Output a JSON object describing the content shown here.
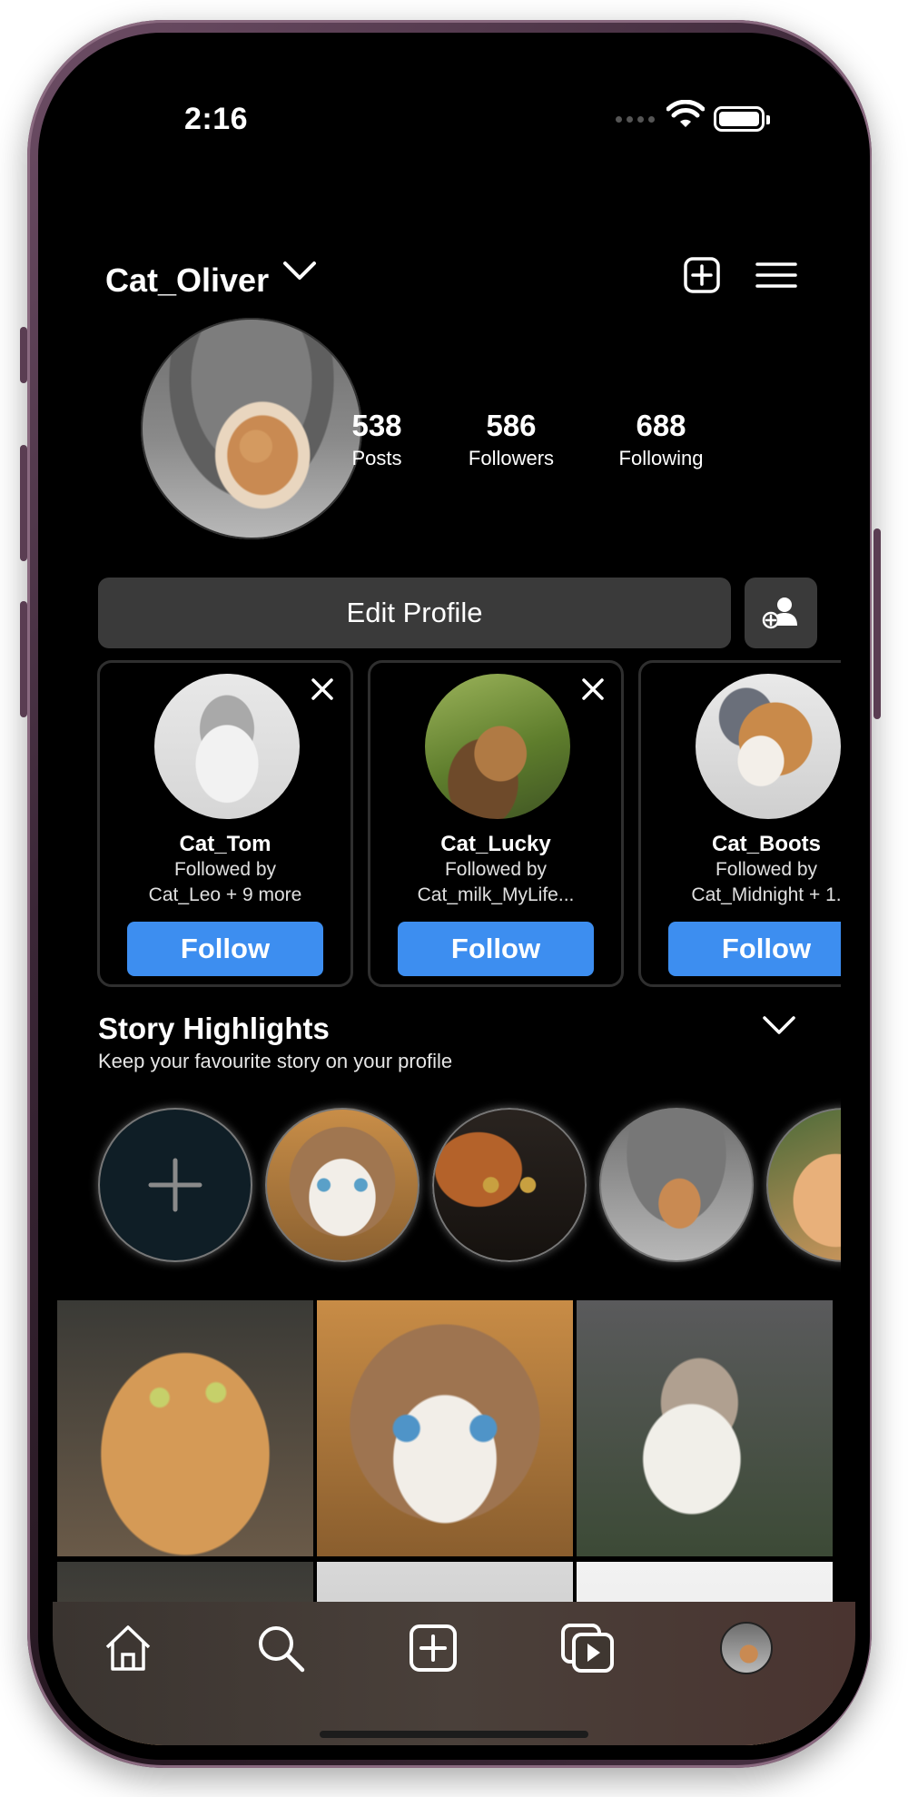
{
  "status_bar": {
    "time": "2:16"
  },
  "header": {
    "username": "Cat_Oliver"
  },
  "stats": [
    {
      "value": "538",
      "label": "Posts"
    },
    {
      "value": "586",
      "label": "Followers"
    },
    {
      "value": "688",
      "label": "Following"
    }
  ],
  "profile": {
    "edit_label": "Edit Profile"
  },
  "suggestions": [
    {
      "name": "Cat_Tom",
      "followed_by": "Followed by",
      "mutuals": "Cat_Leo + 9 more",
      "follow_label": "Follow"
    },
    {
      "name": "Cat_Lucky",
      "followed_by": "Followed by",
      "mutuals": "Cat_milk_MyLife...",
      "follow_label": "Follow"
    },
    {
      "name": "Cat_Boots",
      "followed_by": "Followed by",
      "mutuals": "Cat_Midnight + 1.",
      "follow_label": "Follow"
    }
  ],
  "highlights": {
    "title": "Story Highlights",
    "subtitle": "Keep your favourite story on your profile"
  },
  "tab_bar": {
    "items": [
      "home-icon",
      "search-icon",
      "add-post-icon",
      "reels-icon",
      "profile-avatar"
    ]
  },
  "colors": {
    "accent": "#3d8ef0",
    "button_bg": "#3a3a3a",
    "background": "#000000"
  }
}
